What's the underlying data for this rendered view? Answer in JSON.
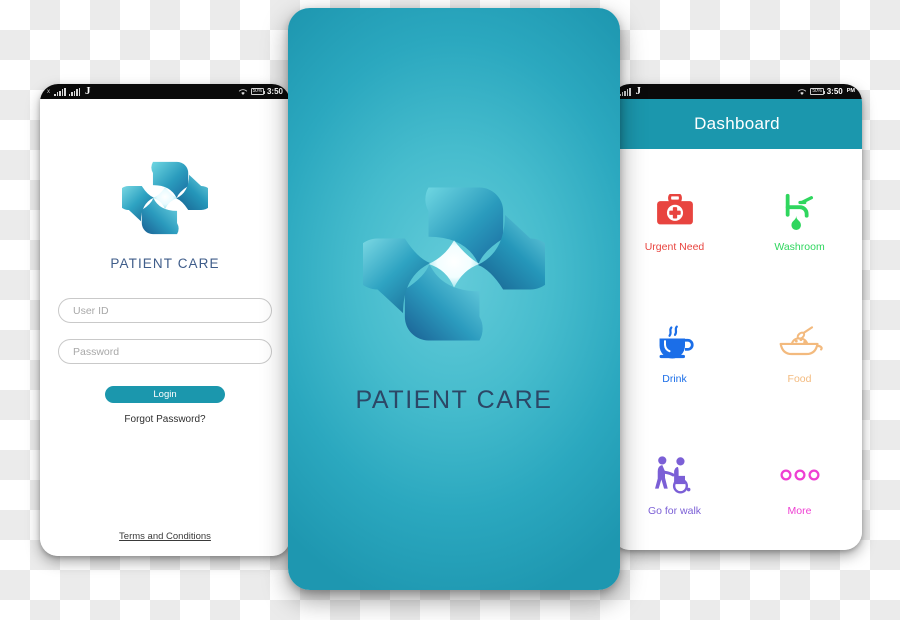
{
  "colors": {
    "brand_teal": "#1b97ad",
    "splash_center": "#63cbd9",
    "splash_edge": "#1e97b0",
    "brand_text_navy": "#3f5d8a",
    "splash_text_navy": "#2c4766",
    "urgent_red": "#e8443f",
    "washroom_green": "#2fd65e",
    "drink_blue": "#1b6ee8",
    "food_orange": "#f3ba7e",
    "walk_purple": "#7b5fd6",
    "more_magenta": "#ee3fd2"
  },
  "status_bar": {
    "carrier_glyph": "J",
    "signal_icon": "signal-bars-icon",
    "wifi_icon": "wifi-icon",
    "battery_level": "50%",
    "time": "3:50",
    "time_with_ampm": "3:50",
    "ampm": "PM"
  },
  "login_screen": {
    "logo_icon": "patient-care-cross-logo",
    "brand_title": "PATIENT CARE",
    "user_id": {
      "placeholder": "User ID",
      "value": ""
    },
    "password": {
      "placeholder": "Password",
      "value": ""
    },
    "login_button": "Login",
    "forgot_password": "Forgot Password?",
    "terms": "Terms  and Conditions"
  },
  "splash_screen": {
    "logo_icon": "patient-care-cross-logo",
    "brand_title": "PATIENT CARE"
  },
  "dashboard_screen": {
    "header_title": "Dashboard",
    "tiles": [
      {
        "label": "Urgent Need",
        "icon": "first-aid-kit-icon",
        "color": "#e8443f"
      },
      {
        "label": "Washroom",
        "icon": "faucet-tap-icon",
        "color": "#2fd65e"
      },
      {
        "label": "Drink",
        "icon": "coffee-cup-icon",
        "color": "#1b6ee8"
      },
      {
        "label": "Food",
        "icon": "bowl-spoon-icon",
        "color": "#f3ba7e"
      },
      {
        "label": "Go for walk",
        "icon": "wheelchair-assist-icon",
        "color": "#7b5fd6"
      },
      {
        "label": "More",
        "icon": "three-dots-icon",
        "color": "#ee3fd2"
      }
    ]
  }
}
